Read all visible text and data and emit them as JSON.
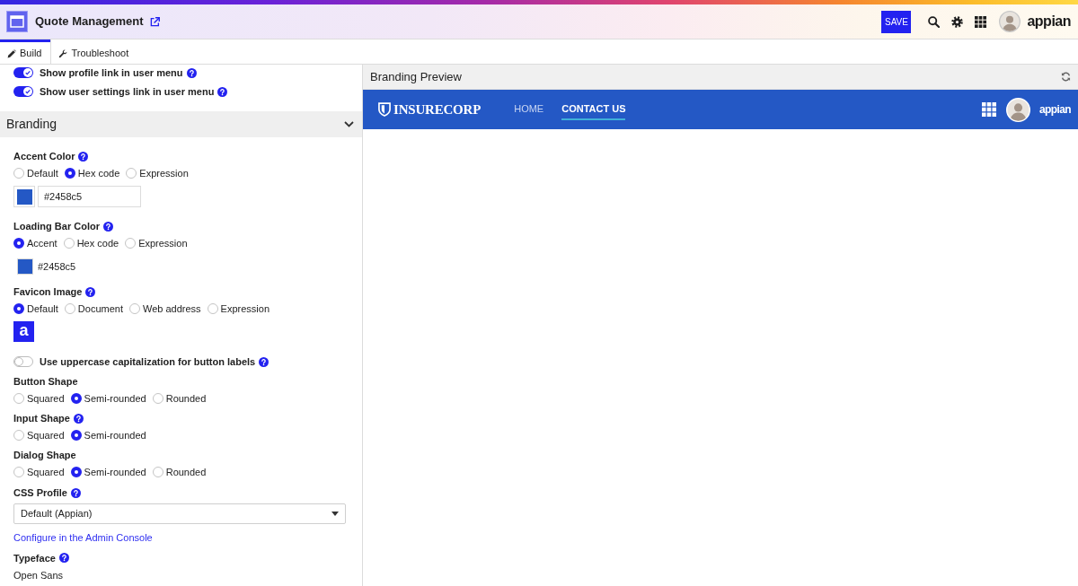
{
  "header": {
    "title": "Quote Management",
    "save_label": "SAVE",
    "logo_text": "appian"
  },
  "tabs": [
    {
      "label": "Build",
      "selected": true
    },
    {
      "label": "Troubleshoot",
      "selected": false
    }
  ],
  "left_panel": {
    "items": [
      {
        "kind": "toggle",
        "label": "Show profile link in user menu",
        "on": true,
        "help": true
      },
      {
        "kind": "toggle",
        "label": "Show user settings link in user menu",
        "on": true,
        "help": true
      },
      {
        "kind": "section",
        "title": "Branding",
        "expanded": true
      },
      {
        "kind": "radios",
        "label": "Accent Color",
        "help": true,
        "options": [
          {
            "label": "Default",
            "selected": false
          },
          {
            "label": "Hex code",
            "selected": true
          },
          {
            "label": "Expression",
            "selected": false
          }
        ],
        "color_input": {
          "color": "#2458c5",
          "value": "#2458c5"
        }
      },
      {
        "kind": "radios",
        "label": "Loading Bar Color",
        "help": true,
        "options": [
          {
            "label": "Accent",
            "selected": true
          },
          {
            "label": "Hex code",
            "selected": false
          },
          {
            "label": "Expression",
            "selected": false
          }
        ],
        "color_swatch": {
          "color": "#2458c5",
          "text": "#2458c5"
        }
      },
      {
        "kind": "radios",
        "label": "Favicon Image",
        "help": true,
        "options": [
          {
            "label": "Default",
            "selected": true
          },
          {
            "label": "Document",
            "selected": false
          },
          {
            "label": "Web address",
            "selected": false
          },
          {
            "label": "Expression",
            "selected": false
          }
        ],
        "favicon": {
          "letter": "a"
        }
      },
      {
        "kind": "toggle",
        "label": "Use uppercase capitalization for button labels",
        "on": false,
        "help": true
      },
      {
        "kind": "radios",
        "label": "Button Shape",
        "help": false,
        "options": [
          {
            "label": "Squared",
            "selected": false
          },
          {
            "label": "Semi-rounded",
            "selected": true
          },
          {
            "label": "Rounded",
            "selected": false
          }
        ]
      },
      {
        "kind": "radios",
        "label": "Input Shape",
        "help": true,
        "options": [
          {
            "label": "Squared",
            "selected": false
          },
          {
            "label": "Semi-rounded",
            "selected": true
          }
        ]
      },
      {
        "kind": "radios",
        "label": "Dialog Shape",
        "help": false,
        "options": [
          {
            "label": "Squared",
            "selected": false
          },
          {
            "label": "Semi-rounded",
            "selected": true
          },
          {
            "label": "Rounded",
            "selected": false
          }
        ]
      },
      {
        "kind": "dropdown",
        "label": "CSS Profile",
        "help": true,
        "value": "Default (Appian)"
      },
      {
        "kind": "link",
        "text": "Configure in the Admin Console"
      },
      {
        "kind": "text",
        "label": "Typeface",
        "help": true,
        "value": "Open Sans"
      }
    ]
  },
  "preview": {
    "title": "Branding Preview",
    "navbar": {
      "brand": "INSURECORP",
      "links": [
        {
          "label": "HOME",
          "selected": false
        },
        {
          "label": "CONTACT US",
          "selected": true
        }
      ],
      "logo_text": "appian"
    }
  }
}
